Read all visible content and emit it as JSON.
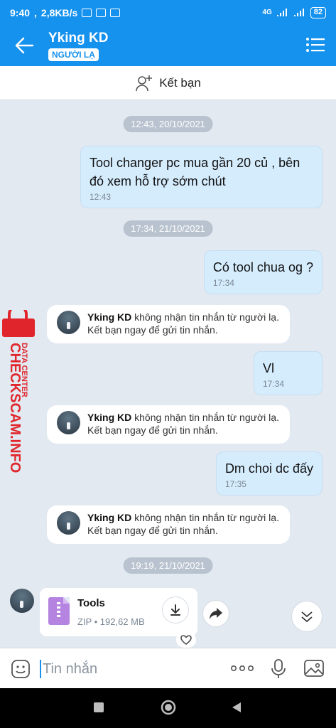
{
  "status_bar": {
    "time": "9:40",
    "speed": "2,8KB/s",
    "network": "4G",
    "battery": "82"
  },
  "header": {
    "title": "Yking KD",
    "badge": "NGƯỜI LẠ"
  },
  "friend_bar": {
    "label": "Kết bạn"
  },
  "messages": [
    {
      "kind": "timestamp",
      "text": "12:43, 20/10/2021"
    },
    {
      "kind": "outgoing",
      "line1": "Tool changer pc mua gần 20 củ , bên",
      "line2": "đó xem hỗ trợ sớm chút",
      "time": "12:43"
    },
    {
      "kind": "timestamp",
      "text": "17:34, 21/10/2021"
    },
    {
      "kind": "outgoing",
      "text": "Có tool chua og ?",
      "time": "17:34"
    },
    {
      "kind": "system",
      "name": "Yking KD",
      "line1": " không nhận tin nhắn từ người lạ.",
      "line2": "Kết bạn ngay để gửi tin nhắn."
    },
    {
      "kind": "outgoing",
      "text": "Vl",
      "time": "17:34"
    },
    {
      "kind": "system",
      "name": "Yking KD",
      "line1": " không nhận tin nhắn từ người lạ.",
      "line2": "Kết bạn ngay để gửi tin nhắn."
    },
    {
      "kind": "outgoing",
      "text": "Dm choi dc đấy",
      "time": "17:35"
    },
    {
      "kind": "system",
      "name": "Yking KD",
      "line1": " không nhận tin nhắn từ người lạ.",
      "line2": "Kết bạn ngay để gửi tin nhắn."
    },
    {
      "kind": "timestamp",
      "text": "19:19, 21/10/2021"
    }
  ],
  "file": {
    "name": "Tools",
    "meta": "ZIP • 192,62 MB"
  },
  "watermark": {
    "line1": "DATA CENTER",
    "line2": "CHECKSCAM.INFO"
  },
  "input": {
    "placeholder": "Tin nhắn"
  },
  "colors": {
    "accent": "#1591ee",
    "bubble_out": "#d5ecfd",
    "watermark": "#e0262c"
  },
  "icons": [
    "back-arrow-icon",
    "list-menu-icon",
    "add-friend-icon",
    "download-icon",
    "forward-icon",
    "heart-icon",
    "scroll-down-icon",
    "sticker-icon",
    "more-icon",
    "mic-icon",
    "image-icon"
  ]
}
